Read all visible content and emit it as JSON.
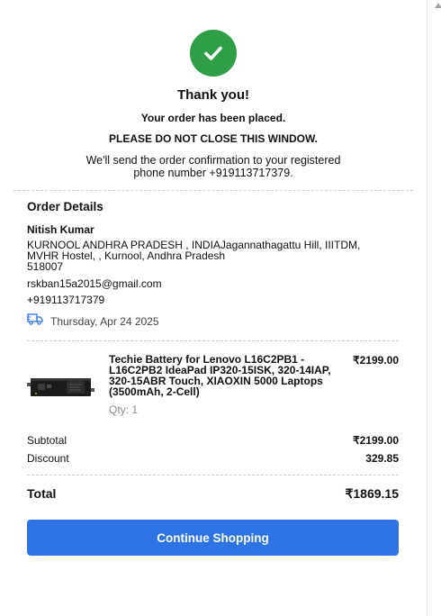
{
  "confirmation": {
    "title": "Thank you!",
    "placed": "Your order has been placed.",
    "warning": "PLEASE DO NOT CLOSE THIS WINDOW.",
    "confirm_line1": "We'll send the order confirmation to your registered",
    "confirm_line2": "phone number +919113717379."
  },
  "order": {
    "heading": "Order Details",
    "name": "Nitish Kumar",
    "address_line1": "KURNOOL ANDHRA PRADESH , INDIAJagannathagattu Hill, IIITDM,",
    "address_line2": "MVHR Hostel, , Kurnool, Andhra Pradesh",
    "address_line3": "518007",
    "email": "rskban15a2015@gmail.com",
    "phone": "+919113717379",
    "delivery_date": "Thursday, Apr 24 2025",
    "delivery_icon": "truck-icon"
  },
  "item": {
    "title_line1": "Techie Battery for Lenovo L16C2PB1 -",
    "title_line2": "L16C2PB2 IdeaPad IP320-15ISK, 320-14IAP,",
    "title_line3": "320-15ABR Touch, XIAOXIN 5000 Laptops",
    "title_line4": "(3500mAh, 2-Cell)",
    "price": "₹2199.00",
    "qty": "Qty: 1"
  },
  "summary": {
    "subtotal_label": "Subtotal",
    "subtotal_value": "₹2199.00",
    "discount_label": "Discount",
    "discount_value": "329.85",
    "total_label": "Total",
    "total_value": "₹1869.15"
  },
  "actions": {
    "continue_label": "Continue Shopping"
  },
  "colors": {
    "success": "#2e9e47",
    "primary": "#2d73e3"
  }
}
